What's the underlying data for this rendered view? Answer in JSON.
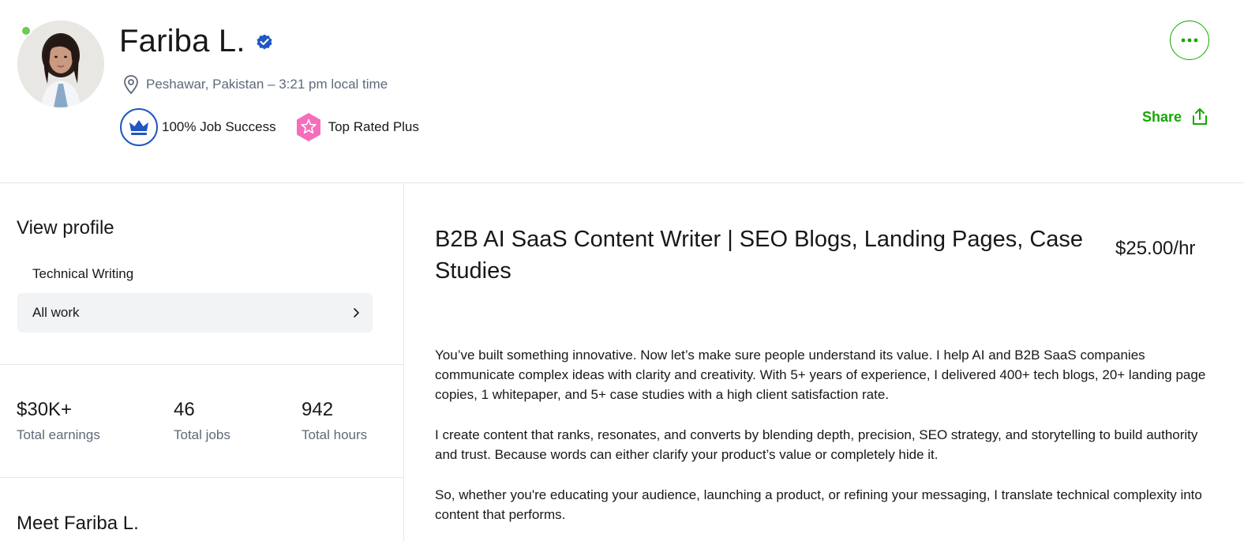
{
  "header": {
    "name": "Fariba L.",
    "location": "Peshawar, Pakistan – 3:21 pm local time",
    "badges": {
      "job_success": "100% Job Success",
      "top_rated": "Top Rated Plus"
    },
    "share_label": "Share",
    "icons": {
      "verified": "verified-check-icon",
      "location": "location-pin-icon",
      "job_success": "crown-icon",
      "top_rated": "star-badge-icon",
      "more": "more-options-icon",
      "share": "share-upload-icon"
    },
    "colors": {
      "accent_green": "#14a800",
      "online": "#6fca5c",
      "verified_blue": "#1f57c3",
      "top_rated_pink": "#f66dbc"
    }
  },
  "sidebar": {
    "view_profile_title": "View profile",
    "specializations": [
      "Technical Writing"
    ],
    "all_work_label": "All work",
    "stats": [
      {
        "value": "$30K+",
        "label": "Total earnings"
      },
      {
        "value": "46",
        "label": "Total jobs"
      },
      {
        "value": "942",
        "label": "Total hours"
      }
    ],
    "meet_title": "Meet Fariba L."
  },
  "main": {
    "title": "B2B AI SaaS Content Writer | SEO Blogs, Landing Pages, Case Studies",
    "rate": "$25.00/hr",
    "overview": [
      "You’ve built something innovative. Now let’s make sure people understand its value. I help AI and B2B SaaS companies communicate complex ideas with clarity and creativity. With 5+ years of experience, I delivered 400+ tech blogs, 20+ landing page copies, 1 whitepaper, and 5+ case studies with a high client satisfaction rate.",
      "I create content that ranks, resonates, and converts by blending depth, precision, SEO strategy, and storytelling to build authority and trust. Because words can either clarify your product’s value or completely hide it.",
      "So, whether you're educating your audience, launching a product, or refining your messaging, I translate technical complexity into content that performs."
    ]
  }
}
